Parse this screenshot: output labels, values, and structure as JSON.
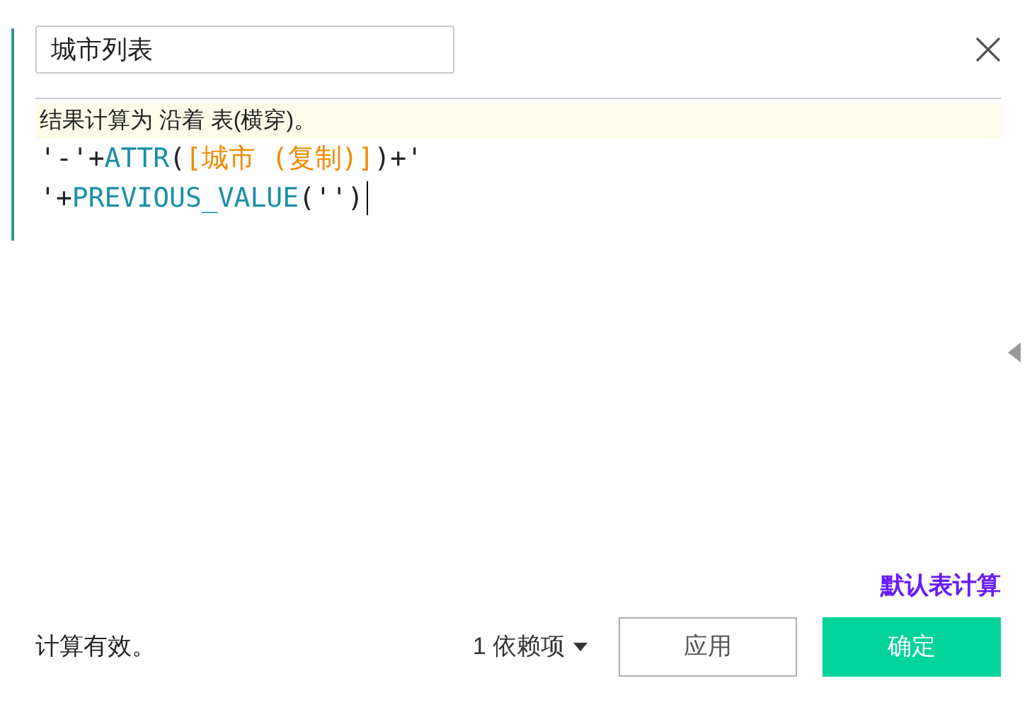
{
  "name_field": {
    "value": "城市列表"
  },
  "hint": "结果计算为 沿着 表(横穿)。",
  "formula_lines": [
    [
      {
        "kind": "plain",
        "text": "'-'+"
      },
      {
        "kind": "function",
        "text": "ATTR"
      },
      {
        "kind": "plain",
        "text": "("
      },
      {
        "kind": "field",
        "text": "[城市 (复制)]"
      },
      {
        "kind": "plain",
        "text": ")+'"
      }
    ],
    [
      {
        "kind": "plain",
        "text": "'+"
      },
      {
        "kind": "function",
        "text": "PREVIOUS_VALUE"
      },
      {
        "kind": "plain",
        "text": "('')"
      }
    ]
  ],
  "default_table_calc_link": "默认表计算",
  "status": "计算有效。",
  "dependencies": "1 依赖项",
  "buttons": [
    {
      "label": "应用",
      "kind": "secondary"
    },
    {
      "label": "确定",
      "kind": "primary"
    }
  ]
}
